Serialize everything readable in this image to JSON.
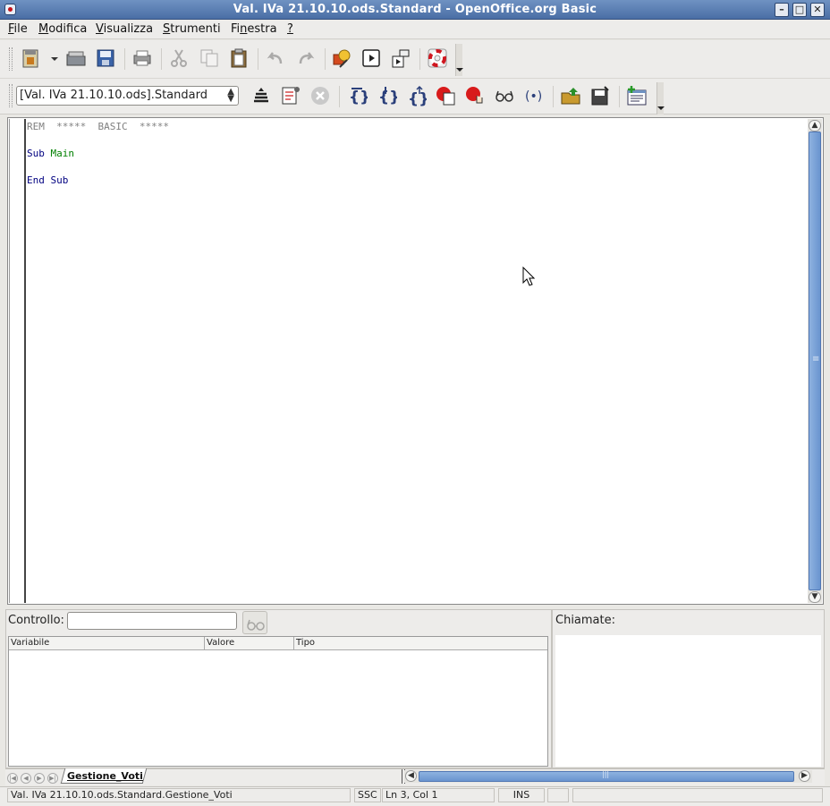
{
  "window": {
    "title": "Val. IVa 21.10.10.ods.Standard - OpenOffice.org Basic",
    "btn_minimize": "–",
    "btn_maximize": "□",
    "btn_close": "✕"
  },
  "menu": [
    {
      "label_u": "F",
      "label_rest": "ile"
    },
    {
      "label_u": "M",
      "label_rest": "odifica"
    },
    {
      "label_u": "V",
      "label_rest": "isualizza"
    },
    {
      "label_u": "S",
      "label_rest": "trumenti"
    },
    {
      "label_pre": "Fi",
      "label_u": "n",
      "label_rest": "estra"
    },
    {
      "label_u": "?",
      "label_rest": ""
    }
  ],
  "library_selector": {
    "value": "[Val. IVa 21.10.10.ods].Standard"
  },
  "editor": {
    "lines": [
      {
        "kw": "REM",
        "rest": "  *****  BASIC  *****"
      },
      {
        "kw": "Sub",
        "name": "Main"
      },
      {
        "kw": "End Sub"
      }
    ]
  },
  "watch": {
    "label": "Controllo:",
    "input_value": "",
    "columns": [
      "Variabile",
      "Valore",
      "Tipo"
    ]
  },
  "calls": {
    "label": "Chiamate:"
  },
  "sheet_tab": {
    "label": "Gestione_Voti"
  },
  "status": {
    "location": "Val. IVa 21.10.10.ods.Standard.Gestione_Voti",
    "ssc": "SSC",
    "position": "Ln 3, Col 1",
    "mode": "INS"
  },
  "colors": {
    "titlebar": "#5b7fb5",
    "keyword": "#000080",
    "identifier": "#008000",
    "comment": "#808080",
    "scroll_thumb": "#7aa2d8"
  }
}
